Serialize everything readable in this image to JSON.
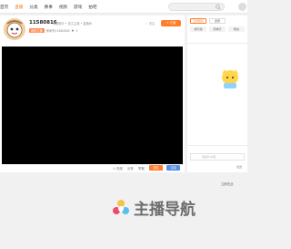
{
  "nav": {
    "items": [
      "首页",
      "直播",
      "分类",
      "赛事",
      "视频",
      "游戏",
      "拍吧"
    ],
    "active_index": 1
  },
  "search": {
    "placeholder": ""
  },
  "streamer": {
    "name": "11580816",
    "subtitle": "粤语聊天 • 英文主播 • 直播间",
    "badge": "我的主播",
    "badge_info": "房间号11580816",
    "level": "3",
    "follow_label": "+ 订阅",
    "follow_count": "☆ 关注"
  },
  "bottom_bar": {
    "views_label": "☉ 在线",
    "share_label": "分享",
    "report_label": "举报",
    "gift_label": "送礼",
    "sub_label": "订阅"
  },
  "side": {
    "tab_1": "王牌陪玩",
    "tab_2": "贵宾",
    "row_1": "排行榜",
    "row_2": "周排行",
    "row_3": "粉丝",
    "chat_placeholder": "说点什么吧",
    "send_label": "发送"
  },
  "more_link": "立即在此",
  "watermark": {
    "text": "主播导航"
  },
  "colors": {
    "accent": "#ff7d2b",
    "blue": "#5b8ee9",
    "video_bg": "#000000"
  }
}
